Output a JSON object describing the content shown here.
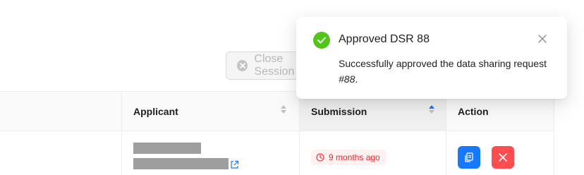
{
  "toolbar": {
    "close_session_label": "Close Session"
  },
  "table": {
    "columns": [
      {
        "label": "Applicant"
      },
      {
        "label": "Submission"
      },
      {
        "label": "Action"
      }
    ],
    "rows": [
      {
        "submission_time": "9 months ago"
      }
    ]
  },
  "toast": {
    "title": "Approved DSR 88",
    "message_prefix": "Successfully approved the data sharing request ",
    "message_ref": "#88",
    "message_suffix": "."
  },
  "colors": {
    "success": "#52c41a",
    "primary": "#1677ff",
    "danger": "#ff4d4f",
    "tag_text": "#f5222d",
    "tag_bg": "#fff1f0"
  }
}
